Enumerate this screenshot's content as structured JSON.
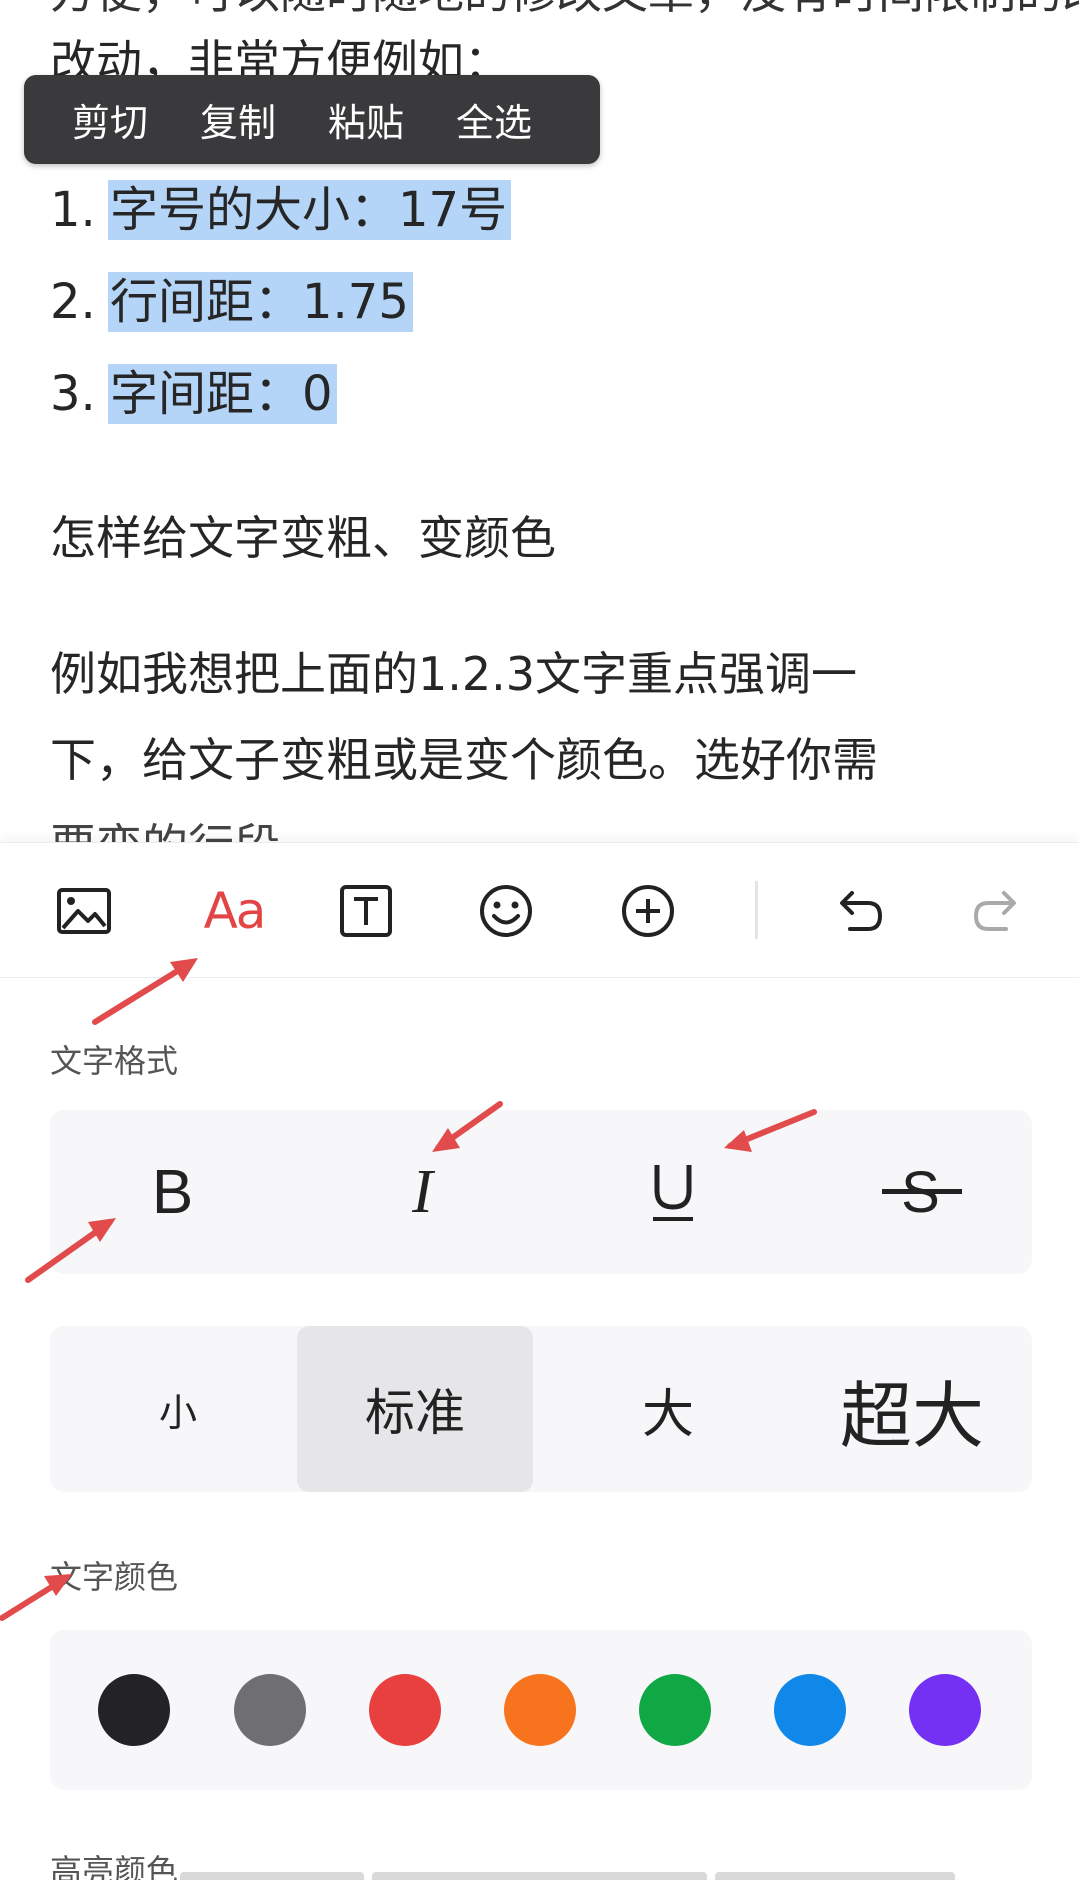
{
  "editor": {
    "cut_line": "方便，可以随时随地的修改文章，没有时间限制的改",
    "line2": "改动，非常方便例如：",
    "list": [
      {
        "num": "1.",
        "text": "字号的大小：17号"
      },
      {
        "num": "2.",
        "text": "行间距：1.75"
      },
      {
        "num": "3.",
        "text": "字间距：0"
      }
    ],
    "heading": "怎样给文字变粗、变颜色",
    "para_line1": "例如我想把上面的1.2.3文字重点强调一",
    "para_line2": "下，给文子变粗或是变个颜色。选好你需",
    "para_line3": "要变的行段"
  },
  "context_menu": {
    "items": [
      "剪切",
      "复制",
      "粘贴",
      "全选"
    ]
  },
  "toolbar": {
    "aa_label": "Aa",
    "icons": [
      "image-icon",
      "text-format-icon",
      "text-box-icon",
      "emoji-icon",
      "add-circle-icon",
      "undo-icon",
      "redo-icon"
    ]
  },
  "panel": {
    "format_label": "文字格式",
    "styles": {
      "bold": "B",
      "italic": "I",
      "underline": "U",
      "strike": "S"
    },
    "sizes": [
      "小",
      "标准",
      "大",
      "超大"
    ],
    "selected_size": "标准",
    "color_label": "文字颜色",
    "colors": [
      "#232226",
      "#6f6f73",
      "#e8403f",
      "#f7731e",
      "#10a845",
      "#0f88ea",
      "#7431f3"
    ],
    "highlight_label": "高亮颜色"
  },
  "annotation_color": "#e14b4b"
}
